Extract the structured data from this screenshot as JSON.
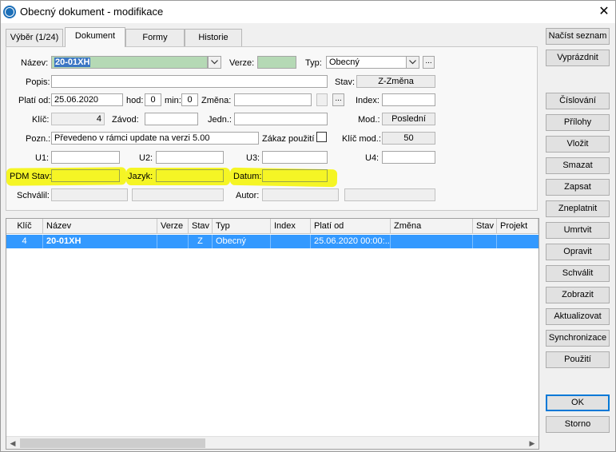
{
  "window": {
    "title": "Obecný dokument - modifikace"
  },
  "tabs": [
    {
      "label": "Výběr (1/24)"
    },
    {
      "label": "Dokument"
    },
    {
      "label": "Formy"
    },
    {
      "label": "Historie"
    }
  ],
  "form": {
    "nazev_label": "Název:",
    "nazev_value": "20-01XH",
    "verze_label": "Verze:",
    "verze_value": "",
    "typ_label": "Typ:",
    "typ_value": "Obecný",
    "popis_label": "Popis:",
    "popis_value": "",
    "stav_label": "Stav:",
    "stav_value": "Z-Změna",
    "plati_od_label": "Platí od:",
    "plati_od_value": "25.06.2020",
    "hod_label": "hod:",
    "hod_value": "0",
    "min_label": "min:",
    "min_value": "0",
    "zmena_label": "Změna:",
    "zmena_value": "",
    "index_label": "Index:",
    "index_value": "",
    "klic_label": "Klíč:",
    "klic_value": "4",
    "zavod_label": "Závod:",
    "zavod_value": "",
    "jedn_label": "Jedn.:",
    "jedn_value": "",
    "mod_label": "Mod.:",
    "mod_value": "Poslední",
    "pozn_label": "Pozn.:",
    "pozn_value": "Převedeno v rámci update na verzi 5.00",
    "zakaz_label": "Zákaz použití",
    "klic_mod_label": "Klíč mod.:",
    "klic_mod_value": "50",
    "u1_label": "U1:",
    "u2_label": "U2:",
    "u3_label": "U3:",
    "u4_label": "U4:",
    "pdm_stav_label": "PDM Stav:",
    "jazyk_label": "Jazyk:",
    "datum_label": "Datum:",
    "schvalil_label": "Schválil:",
    "autor_label": "Autor:",
    "dots": "..."
  },
  "grid": {
    "columns": [
      "Klíč",
      "Název",
      "Verze",
      "Stav",
      "Typ",
      "Index",
      "Platí od",
      "Změna",
      "Stav",
      "Projekt"
    ],
    "rows": [
      {
        "klic": "4",
        "nazev": "20-01XH",
        "verze": "",
        "stav": "Z",
        "typ": "Obecný",
        "index": "",
        "plati_od": "25.06.2020 00:00:...",
        "zmena": "",
        "stav2": "",
        "projekt": ""
      }
    ]
  },
  "buttons": {
    "nacist_seznam": "Načíst seznam",
    "vyprazdnit": "Vyprázdnit",
    "cislovani": "Číslování",
    "prilohy": "Přílohy",
    "vlozit": "Vložit",
    "smazat": "Smazat",
    "zapsat": "Zapsat",
    "zneplatnit": "Zneplatnit",
    "umrtvit": "Umrtvit",
    "opravit": "Opravit",
    "schvalit": "Schválit",
    "zobrazit": "Zobrazit",
    "aktualizovat": "Aktualizovat",
    "synchronizace": "Synchronizace",
    "pouziti": "Použití",
    "ok": "OK",
    "storno": "Storno"
  },
  "colors": {
    "selection": "#3399ff",
    "highlight": "#f4f400",
    "accent": "#0078d7"
  },
  "icons": {
    "app": "app-logo-icon",
    "close": "close-icon",
    "dropdown": "chevron-down-icon"
  }
}
